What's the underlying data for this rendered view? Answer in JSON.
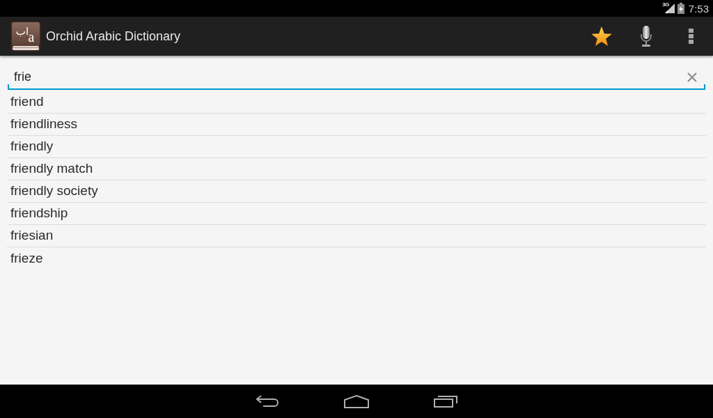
{
  "status_bar": {
    "network": "3G",
    "time": "7:53"
  },
  "action_bar": {
    "logo": {
      "arabic": "اب",
      "latin": "a"
    },
    "title": "Orchid Arabic Dictionary"
  },
  "search": {
    "value": "frie"
  },
  "results": [
    "friend",
    "friendliness",
    "friendly",
    "friendly match",
    "friendly society",
    "friendship",
    "friesian",
    "frieze"
  ]
}
